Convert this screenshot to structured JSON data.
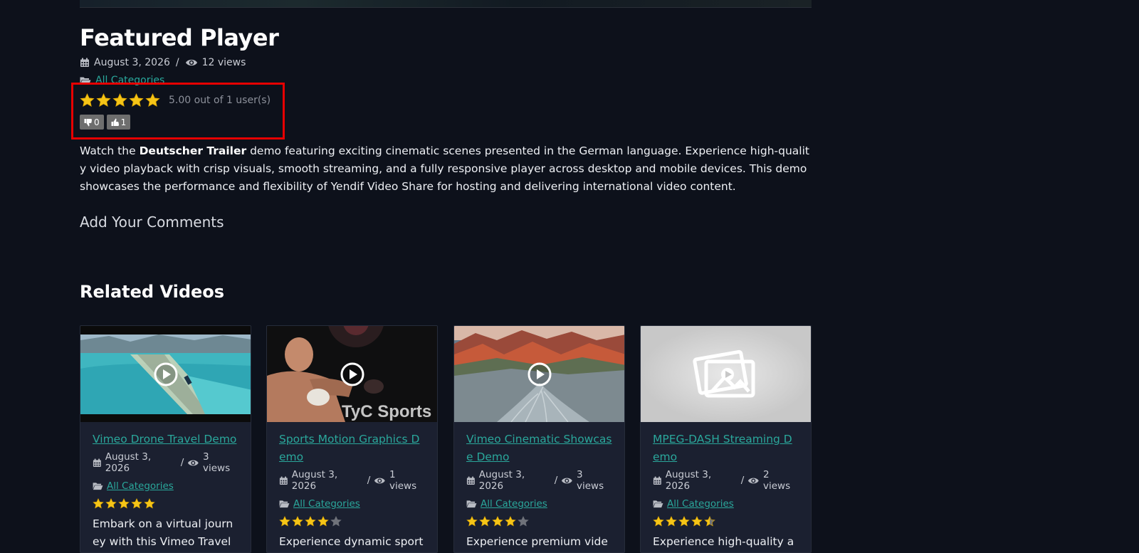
{
  "page": {
    "title": "Featured Player",
    "date": "August 3, 2026",
    "date_sep": "/",
    "views": "12 views",
    "category": "All Categories",
    "rating": {
      "stars": 5,
      "max": 5,
      "text": "5.00 out of 1 user(s)"
    },
    "votes": {
      "dislike_count": "0",
      "like_count": "1"
    },
    "description": {
      "prefix": "Watch the ",
      "bold": "Deutscher Trailer",
      "suffix": " demo featuring exciting cinematic scenes presented in the German language. Experience high-quality video playback with crisp visuals, smooth streaming, and a fully responsive player across desktop and mobile devices. This demo showcases the performance and flexibility of Yendif Video Share for hosting and delivering international video content."
    },
    "comments_heading": "Add Your Comments"
  },
  "related": {
    "heading": "Related Videos",
    "videos": [
      {
        "title": "Vimeo Drone Travel Demo",
        "date": "August 3, 2026",
        "sep": "/",
        "views": "3 views",
        "category": "All Categories",
        "rating": 5,
        "description": "Embark on a virtual journey with this Vimeo Travel de",
        "thumb": "drone-coast"
      },
      {
        "title": "Sports Motion Graphics Demo",
        "date": "August 3, 2026",
        "sep": "/",
        "views": "1 views",
        "category": "All Categories",
        "rating": 4,
        "description": "Experience dynamic sports",
        "thumb": "boxer",
        "thumb_text": "TyC Sports"
      },
      {
        "title": "Vimeo Cinematic Showcase Demo",
        "date": "August 3, 2026",
        "sep": "/",
        "views": "3 views",
        "category": "All Categories",
        "rating": 4,
        "description": "Experience premium video",
        "thumb": "mountains"
      },
      {
        "title": "MPEG-DASH Streaming Demo",
        "date": "August 3, 2026",
        "sep": "/",
        "views": "2 views",
        "category": "All Categories",
        "rating": 4.5,
        "description": "Experience high-quality ad",
        "thumb": "placeholder"
      }
    ]
  },
  "colors": {
    "background": "#0d111b",
    "accent_link": "#2aa79b",
    "star": "#f5c518",
    "highlight_border": "#e60000",
    "card_bg": "#1b2030"
  }
}
